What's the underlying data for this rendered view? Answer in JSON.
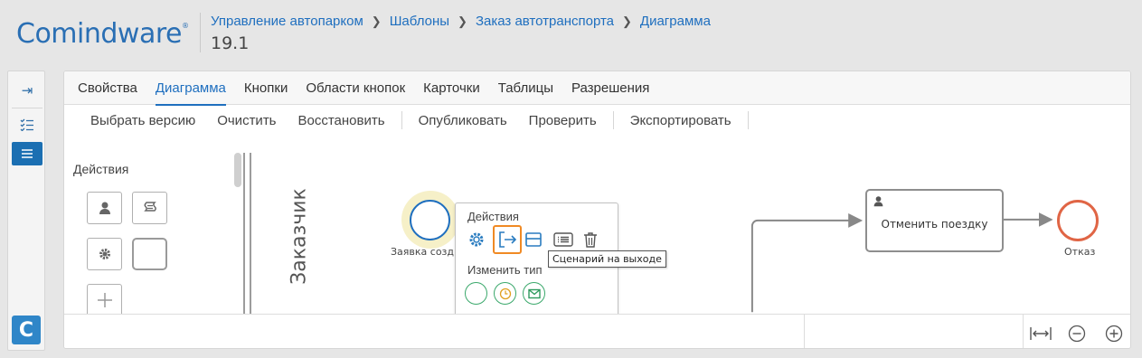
{
  "header": {
    "logo_text": "Comindware",
    "logo_mark": "®",
    "breadcrumbs": [
      "Управление автопарком",
      "Шаблоны",
      "Заказ автотранспорта",
      "Диаграмма"
    ],
    "version": "19.1"
  },
  "rail": {
    "items": [
      {
        "icon": "expand-panel-icon",
        "glyph": "⇥"
      },
      {
        "icon": "checklist-icon",
        "glyph": "☰"
      },
      {
        "icon": "list-icon",
        "glyph": "≡"
      }
    ],
    "app_badge": "C"
  },
  "tabs": [
    "Свойства",
    "Диаграмма",
    "Кнопки",
    "Области кнопок",
    "Карточки",
    "Таблицы",
    "Разрешения"
  ],
  "active_tab": "Диаграмма",
  "toolbar": {
    "select_version": "Выбрать версию",
    "clear": "Очистить",
    "restore": "Восстановить",
    "publish": "Опубликовать",
    "validate": "Проверить",
    "export": "Экспортировать"
  },
  "palette": {
    "title": "Действия"
  },
  "lane": {
    "label": "Заказчик"
  },
  "diagram": {
    "start_event_label": "Заявка созд",
    "task_title": "Отменить поездку",
    "end_event_label": "Отказ"
  },
  "context_menu": {
    "actions_title": "Действия",
    "change_type_title": "Изменить тип",
    "tooltip": "Сценарий на выходе"
  },
  "colors": {
    "brand": "#2a6fb4",
    "accent": "#1f6fbf",
    "highlight": "#f08a24",
    "end_event": "#e06545",
    "type_green": "#3aa86b"
  }
}
